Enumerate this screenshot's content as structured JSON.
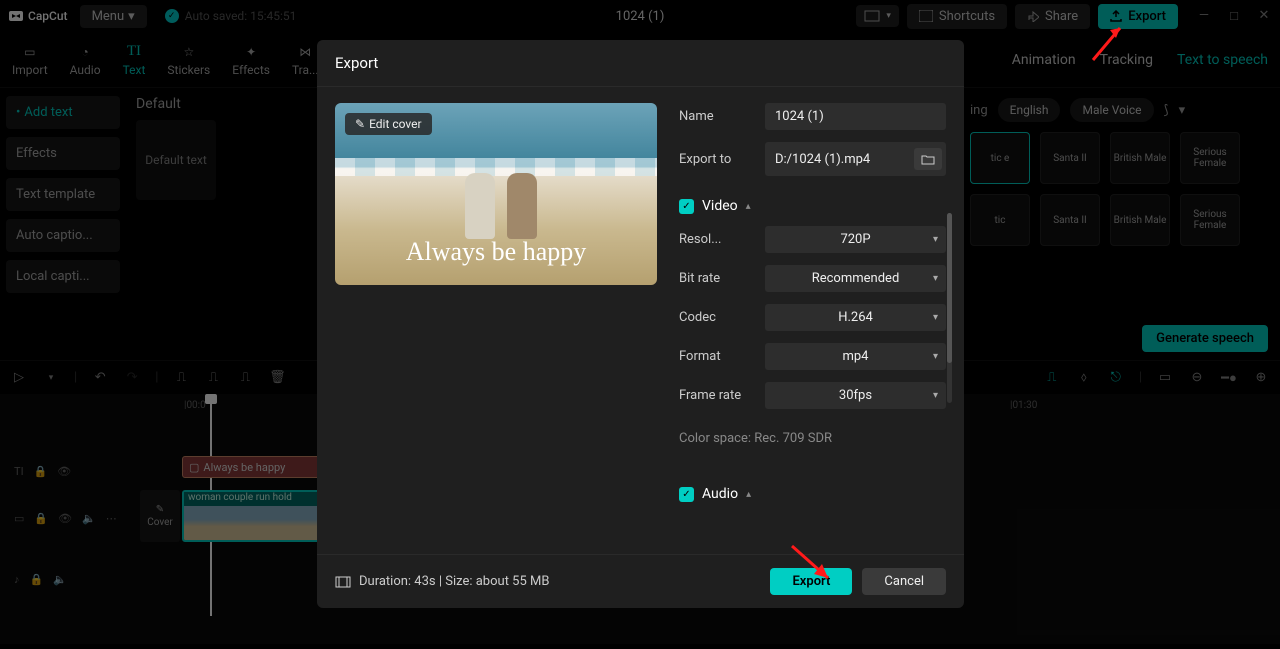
{
  "titlebar": {
    "logo": "CapCut",
    "menu": "Menu",
    "autosave": "Auto saved: 15:45:51",
    "project": "1024 (1)",
    "shortcuts": "Shortcuts",
    "share": "Share",
    "export": "Export"
  },
  "toolbar": {
    "import": "Import",
    "audio": "Audio",
    "text": "Text",
    "stickers": "Stickers",
    "effects": "Effects",
    "transition": "Tra..."
  },
  "right_tabs": {
    "animation": "Animation",
    "tracking": "Tracking",
    "tts": "Text to speech"
  },
  "sidebar": {
    "add_text": "Add text",
    "effects": "Effects",
    "template": "Text template",
    "auto_cap": "Auto captio...",
    "local_cap": "Local capti..."
  },
  "content": {
    "default": "Default",
    "default_text": "Default text"
  },
  "voice_panel": {
    "lang_label": "ing",
    "english": "English",
    "male_voice": "Male Voice",
    "cards": [
      "tic e",
      "Santa II",
      "British Male",
      "Serious Female",
      "tic",
      "Santa II",
      "British Male",
      "Serious Female"
    ],
    "generate": "Generate speech"
  },
  "timeline": {
    "ticks": [
      "|00:0",
      "|01:30"
    ],
    "text_clip": "Always be happy",
    "video_clip": "woman couple run hold",
    "cover": "Cover"
  },
  "modal": {
    "title": "Export",
    "edit_cover": "Edit cover",
    "cover_caption": "Always be happy",
    "name_label": "Name",
    "name_value": "1024 (1)",
    "exportto_label": "Export to",
    "exportto_value": "D:/1024 (1).mp4",
    "video_section": "Video",
    "resolution_label": "Resol...",
    "resolution_value": "720P",
    "bitrate_label": "Bit rate",
    "bitrate_value": "Recommended",
    "codec_label": "Codec",
    "codec_value": "H.264",
    "format_label": "Format",
    "format_value": "mp4",
    "framerate_label": "Frame rate",
    "framerate_value": "30fps",
    "colorspace": "Color space: Rec. 709 SDR",
    "audio_section": "Audio",
    "duration_info": "Duration: 43s | Size: about 55 MB",
    "export_btn": "Export",
    "cancel_btn": "Cancel"
  }
}
